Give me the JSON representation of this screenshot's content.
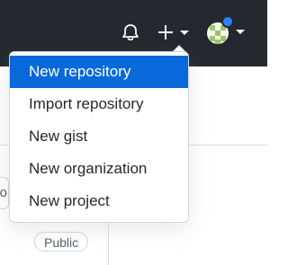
{
  "header": {
    "icons": [
      "bell-icon",
      "plus-icon",
      "chevron-down-icon",
      "avatar",
      "notification-dot"
    ],
    "background_color": "#24292f"
  },
  "create_menu": {
    "items": [
      {
        "label": "New repository",
        "active": true
      },
      {
        "label": "Import repository",
        "active": false
      },
      {
        "label": "New gist",
        "active": false
      },
      {
        "label": "New organization",
        "active": false
      },
      {
        "label": "New project",
        "active": false
      }
    ],
    "highlight_color": "#0969da"
  },
  "background": {
    "partial_input_text": "to",
    "badge": "Public"
  }
}
